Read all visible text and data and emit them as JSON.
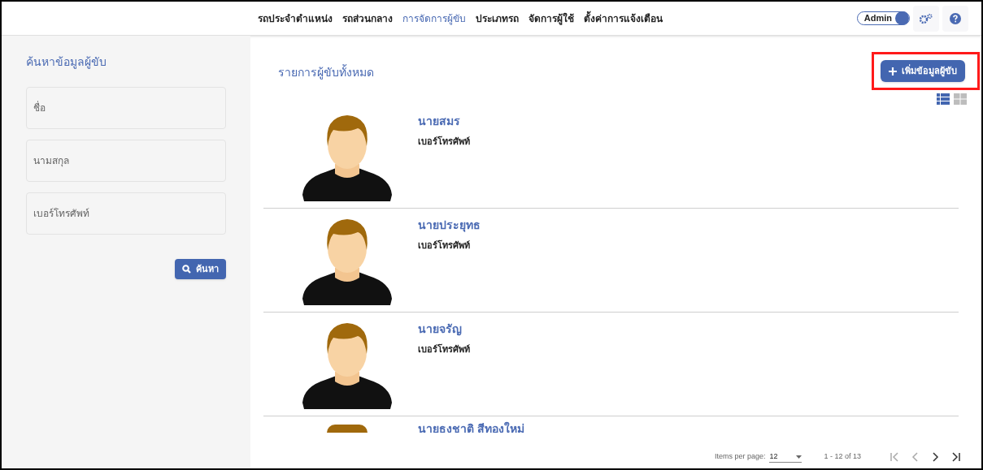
{
  "nav": [
    {
      "label": "รถประจำตำแหน่ง",
      "selected": false
    },
    {
      "label": "รถส่วนกลาง",
      "selected": false
    },
    {
      "label": "การจัดการผู้ขับ",
      "selected": true
    },
    {
      "label": "ประเภทรถ",
      "selected": false
    },
    {
      "label": "จัดการผู้ใช้",
      "selected": false
    },
    {
      "label": "ตั้งค่าการแจ้งเตือน",
      "selected": false
    }
  ],
  "admin_toggle": {
    "label": "Admin",
    "on": true
  },
  "sidebar": {
    "title": "ค้นหาข้อมูลผู้ขับ",
    "fields": [
      {
        "placeholder": "ชื่อ"
      },
      {
        "placeholder": "นามสกุล"
      },
      {
        "placeholder": "เบอร์โทรศัพท์"
      }
    ],
    "search_button": "ค้นหา"
  },
  "main": {
    "title": "รายการผู้ขับทั้งหมด",
    "add_button": "เพิ่มข้อมูลผู้ขับ",
    "views": [
      {
        "kind": "list",
        "selected": true
      },
      {
        "kind": "grid",
        "selected": false
      }
    ],
    "drivers": [
      {
        "name": "นายสมร",
        "phone_label": "เบอร์โทรศัพท์"
      },
      {
        "name": "นายประยุทธ",
        "phone_label": "เบอร์โทรศัพท์"
      },
      {
        "name": "นายจรัญ",
        "phone_label": "เบอร์โทรศัพท์"
      },
      {
        "name": "นายธงชาติ สีทองใหม่"
      }
    ]
  },
  "paginator": {
    "items_per_page_label": "Items per page:",
    "items_per_page": "12",
    "range": "1 - 12 of 13"
  }
}
